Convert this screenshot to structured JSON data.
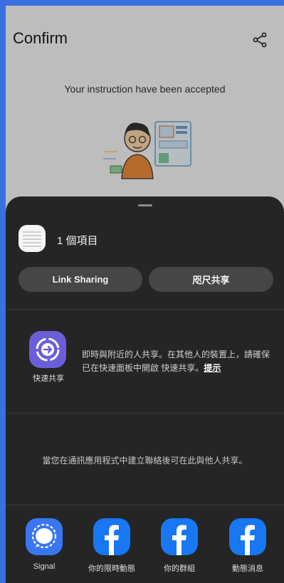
{
  "app": {
    "title": "Confirm",
    "accepted_message": "Your instruction have been accepted"
  },
  "sheet": {
    "item_count": "1 個項目",
    "buttons": {
      "link_sharing": "Link Sharing",
      "nearby_share": "咫尺共享"
    },
    "quick_share": {
      "label": "快速共享",
      "description": "即時與附近的人共享。在其他人的裝置上，請確保已在快速面板中開啟 快速共享。",
      "tip": "提示"
    },
    "contacts_message": "當您在通訊應用程式中建立聯絡後可在此與他人共享。",
    "apps": [
      {
        "label": "Signal",
        "icon": "signal-icon"
      },
      {
        "label": "你的限時動態",
        "icon": "facebook-icon"
      },
      {
        "label": "你的群組",
        "icon": "facebook-icon"
      },
      {
        "label": "動態消息",
        "icon": "facebook-icon"
      }
    ]
  },
  "colors": {
    "accent_blue": "#3b6fe0",
    "sheet_bg": "#252525",
    "quick_share": "#6a5fd8",
    "signal": "#3a76f0",
    "facebook": "#1877f2"
  }
}
